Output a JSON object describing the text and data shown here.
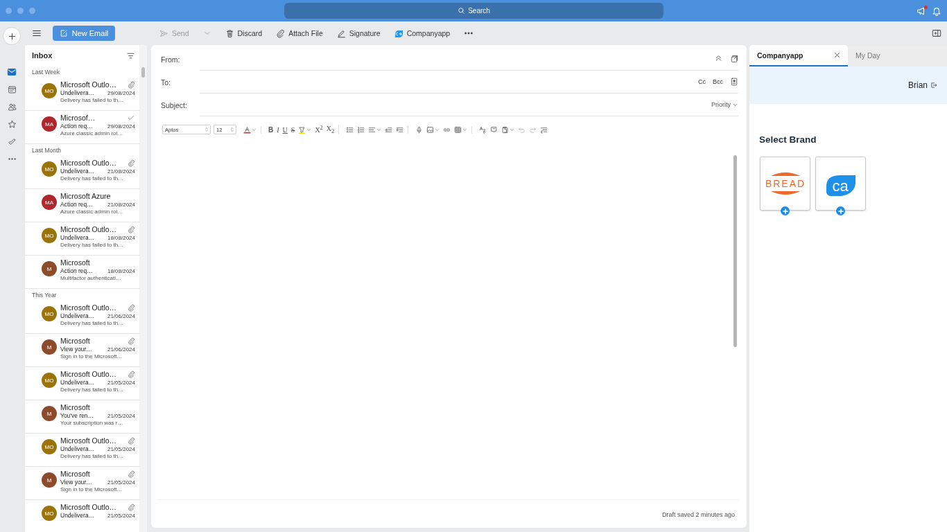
{
  "window": {
    "search": "Search"
  },
  "nav": [
    {
      "kind": "mail",
      "selected": true
    },
    {
      "kind": "calendar",
      "selected": false
    },
    {
      "kind": "people",
      "selected": false
    },
    {
      "kind": "star",
      "selected": false
    },
    {
      "kind": "todo",
      "selected": false
    },
    {
      "kind": "more",
      "selected": false
    }
  ],
  "toolbar": {
    "new_email": "New Email",
    "actions": [
      {
        "kind": "send",
        "label": "Send",
        "disabled": true
      },
      {
        "kind": "discard",
        "label": "Discard",
        "disabled": false
      },
      {
        "kind": "attach",
        "label": "Attach File",
        "disabled": false
      },
      {
        "kind": "signature",
        "label": "Signature",
        "disabled": false
      },
      {
        "kind": "app",
        "label": "Companyapp",
        "disabled": false
      }
    ]
  },
  "mail_list": {
    "title": "Inbox",
    "groups": [
      {
        "label": "Last Week",
        "messages": [
          {
            "initials": "MO",
            "color": "#9b7409",
            "sender": "Microsoft Outlo…",
            "attachment": true,
            "done": false,
            "subject": "Undelivera…",
            "date": "29/08/2024",
            "preview": "Delivery has failed to th…"
          },
          {
            "initials": "MA",
            "color": "#b0262c",
            "sender": "Microsof…",
            "attachment": false,
            "done": true,
            "subject": "Action req…",
            "date": "29/08/2024",
            "preview": "Azure classic admin rol…"
          }
        ]
      },
      {
        "label": "Last Month",
        "messages": [
          {
            "initials": "MO",
            "color": "#9b7409",
            "sender": "Microsoft Outlo…",
            "attachment": true,
            "done": false,
            "subject": "Undelivera…",
            "date": "21/08/2024",
            "preview": "Delivery has failed to th…"
          },
          {
            "initials": "MA",
            "color": "#b0262c",
            "sender": "Microsoft Azure",
            "attachment": false,
            "done": false,
            "subject": "Action req…",
            "date": "21/08/2024",
            "preview": "Azure classic admin rol…"
          },
          {
            "initials": "MO",
            "color": "#9b7409",
            "sender": "Microsoft Outlo…",
            "attachment": true,
            "done": false,
            "subject": "Undelivera…",
            "date": "18/08/2024",
            "preview": "Delivery has failed to th…"
          },
          {
            "initials": "M",
            "color": "#8c4b29",
            "sender": "Microsoft",
            "attachment": false,
            "done": false,
            "subject": "Action req…",
            "date": "18/08/2024",
            "preview": "Multifactor authenticati…"
          }
        ]
      },
      {
        "label": "This Year",
        "messages": [
          {
            "initials": "MO",
            "color": "#9b7409",
            "sender": "Microsoft Outlo…",
            "attachment": true,
            "done": false,
            "subject": "Undelivera…",
            "date": "21/06/2024",
            "preview": "Delivery has failed to th…"
          },
          {
            "initials": "M",
            "color": "#8c4b29",
            "sender": "Microsoft",
            "attachment": true,
            "done": false,
            "subject": "View your…",
            "date": "21/06/2024",
            "preview": "Sign in to the Microsoft…"
          },
          {
            "initials": "MO",
            "color": "#9b7409",
            "sender": "Microsoft Outlo…",
            "attachment": true,
            "done": false,
            "subject": "Undelivera…",
            "date": "21/05/2024",
            "preview": "Delivery has failed to th…"
          },
          {
            "initials": "M",
            "color": "#8c4b29",
            "sender": "Microsoft",
            "attachment": false,
            "done": false,
            "subject": "You've ren…",
            "date": "21/05/2024",
            "preview": "Your subscription was r…"
          },
          {
            "initials": "MO",
            "color": "#9b7409",
            "sender": "Microsoft Outlo…",
            "attachment": true,
            "done": false,
            "subject": "Undelivera…",
            "date": "21/05/2024",
            "preview": "Delivery has failed to th…"
          },
          {
            "initials": "M",
            "color": "#8c4b29",
            "sender": "Microsoft",
            "attachment": true,
            "done": false,
            "subject": "View your…",
            "date": "21/05/2024",
            "preview": "Sign in to the Microsoft…"
          },
          {
            "initials": "MO",
            "color": "#9b7409",
            "sender": "Microsoft Outlo…",
            "attachment": true,
            "done": false,
            "subject": "Undelivera…",
            "date": "21/05/2024"
          }
        ]
      }
    ]
  },
  "compose": {
    "from_label": "From:",
    "to_label": "To:",
    "subject_label": "Subject:",
    "cc": "Cc",
    "bcc": "Bcc",
    "priority": "Priority",
    "font": "Aptos",
    "size": "12",
    "format_groups": [
      [
        {
          "kind": "font-color",
          "dropdown": true,
          "disabled": false
        }
      ],
      [
        {
          "kind": "bold",
          "label": "B",
          "dropdown": false,
          "disabled": false
        },
        {
          "kind": "italic",
          "label": "I",
          "dropdown": false,
          "disabled": false
        },
        {
          "kind": "underline",
          "label": "U",
          "dropdown": false,
          "disabled": false
        },
        {
          "kind": "strike",
          "label": "S",
          "dropdown": false,
          "disabled": false
        },
        {
          "kind": "highlight",
          "dropdown": true,
          "disabled": false
        },
        {
          "kind": "script",
          "label": "X$^{2}$",
          "dropdown": false,
          "disabled": false
        },
        {
          "kind": "script",
          "label": "X$_{2}$",
          "dropdown": false,
          "disabled": false
        }
      ],
      [
        {
          "kind": "bullets",
          "dropdown": false,
          "disabled": false
        },
        {
          "kind": "numbering",
          "dropdown": false,
          "disabled": false
        },
        {
          "kind": "align",
          "dropdown": true,
          "disabled": false
        },
        {
          "kind": "outdent",
          "dropdown": false,
          "disabled": false
        },
        {
          "kind": "indent",
          "dropdown": false,
          "disabled": false
        }
      ],
      [
        {
          "kind": "dictate",
          "dropdown": false,
          "disabled": false
        },
        {
          "kind": "image",
          "dropdown": true,
          "disabled": false
        },
        {
          "kind": "link",
          "dropdown": false,
          "disabled": false
        },
        {
          "kind": "table",
          "dropdown": true,
          "disabled": false
        }
      ],
      [
        {
          "kind": "editor",
          "dropdown": false,
          "disabled": false
        },
        {
          "kind": "sensitivity",
          "dropdown": false,
          "disabled": false
        },
        {
          "kind": "paste",
          "dropdown": true,
          "disabled": false
        },
        {
          "kind": "undo",
          "dropdown": false,
          "disabled": true
        },
        {
          "kind": "redo",
          "dropdown": false,
          "disabled": true
        },
        {
          "kind": "rtl",
          "dropdown": false,
          "disabled": false
        }
      ]
    ],
    "status": "Draft saved 2 minutes ago"
  },
  "addin": {
    "tabs": [
      {
        "label": "Companyapp",
        "selected": true,
        "closable": true
      },
      {
        "label": "My Day",
        "selected": false,
        "closable": false
      }
    ],
    "user": "Brian",
    "heading": "Select Brand",
    "brands": [
      {
        "kind": "bread",
        "logo_text": "BREAD"
      },
      {
        "kind": "ca",
        "logo_text": "ca"
      }
    ]
  }
}
